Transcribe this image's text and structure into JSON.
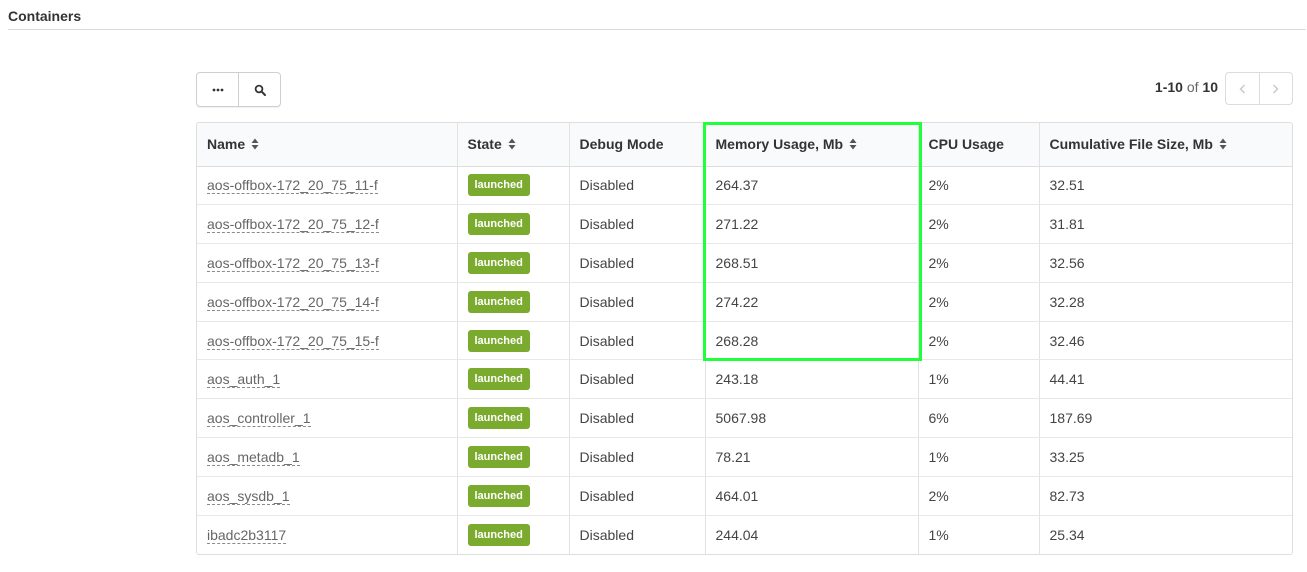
{
  "page": {
    "title": "Containers"
  },
  "toolbar": {
    "more_icon": "more-dots-icon",
    "search_icon": "search-icon"
  },
  "pagination": {
    "range": "1-10",
    "of": "of",
    "total": "10",
    "prev_icon": "chevron-left-icon",
    "next_icon": "chevron-right-icon"
  },
  "table": {
    "columns": [
      {
        "label": "Name",
        "sortable": true
      },
      {
        "label": "State",
        "sortable": true
      },
      {
        "label": "Debug Mode",
        "sortable": false
      },
      {
        "label": "Memory Usage, Mb",
        "sortable": true
      },
      {
        "label": "CPU Usage",
        "sortable": false
      },
      {
        "label": "Cumulative File Size, Mb",
        "sortable": true
      }
    ],
    "rows": [
      {
        "name": "aos-offbox-172_20_75_11-f",
        "state": "launched",
        "debug": "Disabled",
        "memory": "264.37",
        "cpu": "2%",
        "file_size": "32.51"
      },
      {
        "name": "aos-offbox-172_20_75_12-f",
        "state": "launched",
        "debug": "Disabled",
        "memory": "271.22",
        "cpu": "2%",
        "file_size": "31.81"
      },
      {
        "name": "aos-offbox-172_20_75_13-f",
        "state": "launched",
        "debug": "Disabled",
        "memory": "268.51",
        "cpu": "2%",
        "file_size": "32.56"
      },
      {
        "name": "aos-offbox-172_20_75_14-f",
        "state": "launched",
        "debug": "Disabled",
        "memory": "274.22",
        "cpu": "2%",
        "file_size": "32.28"
      },
      {
        "name": "aos-offbox-172_20_75_15-f",
        "state": "launched",
        "debug": "Disabled",
        "memory": "268.28",
        "cpu": "2%",
        "file_size": "32.46"
      },
      {
        "name": "aos_auth_1",
        "state": "launched",
        "debug": "Disabled",
        "memory": "243.18",
        "cpu": "1%",
        "file_size": "44.41"
      },
      {
        "name": "aos_controller_1",
        "state": "launched",
        "debug": "Disabled",
        "memory": "5067.98",
        "cpu": "6%",
        "file_size": "187.69"
      },
      {
        "name": "aos_metadb_1",
        "state": "launched",
        "debug": "Disabled",
        "memory": "78.21",
        "cpu": "1%",
        "file_size": "33.25"
      },
      {
        "name": "aos_sysdb_1",
        "state": "launched",
        "debug": "Disabled",
        "memory": "464.01",
        "cpu": "2%",
        "file_size": "82.73"
      },
      {
        "name": "ibadc2b3117",
        "state": "launched",
        "debug": "Disabled",
        "memory": "244.04",
        "cpu": "1%",
        "file_size": "25.34"
      }
    ]
  },
  "colors": {
    "badge": "#7aab2e",
    "highlight": "#1fff3a",
    "header_bg": "#f9fafb"
  }
}
